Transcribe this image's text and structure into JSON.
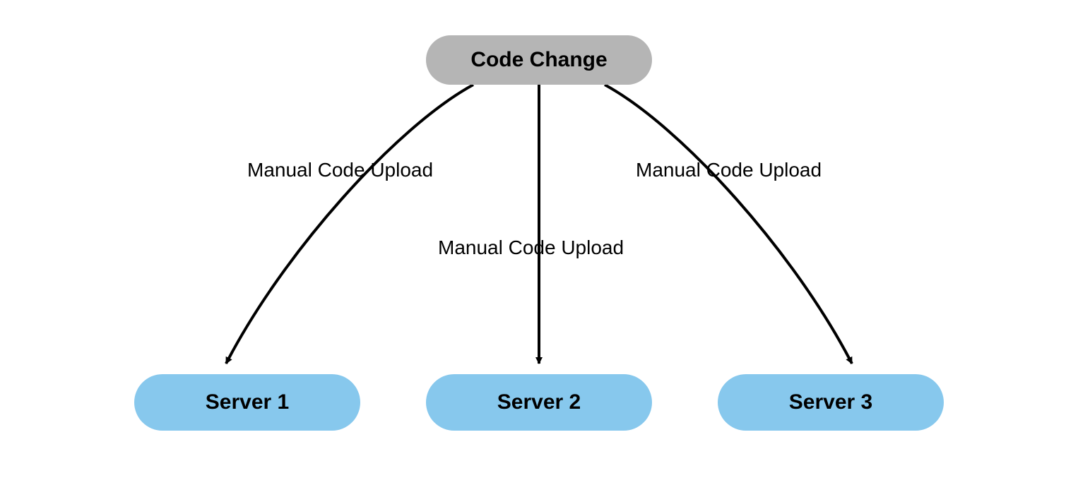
{
  "source": {
    "label": "Code Change"
  },
  "edges": [
    {
      "label": "Manual Code Upload"
    },
    {
      "label": "Manual Code Upload"
    },
    {
      "label": "Manual Code Upload"
    }
  ],
  "targets": [
    {
      "label": "Server 1"
    },
    {
      "label": "Server 2"
    },
    {
      "label": "Server 3"
    }
  ],
  "colors": {
    "source_bg": "#b5b5b5",
    "target_bg": "#87c8ed",
    "arrow": "#000000"
  }
}
